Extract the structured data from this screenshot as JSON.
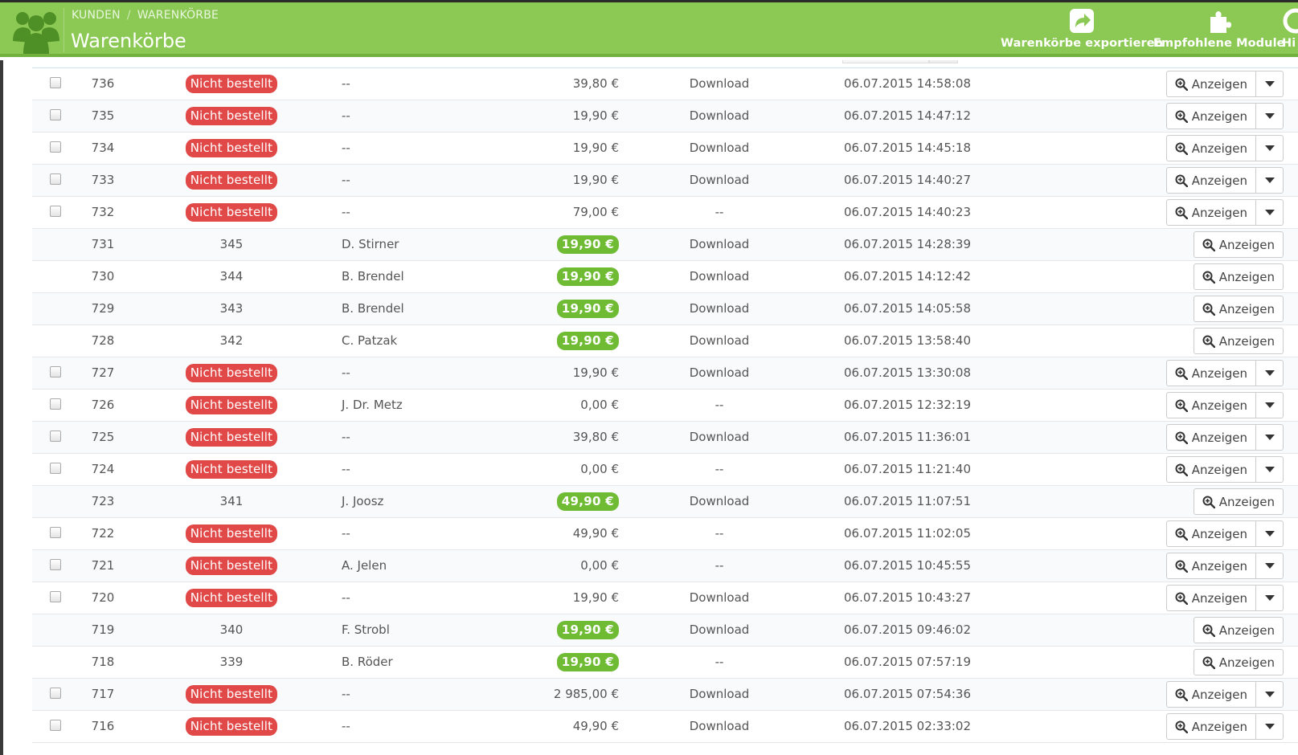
{
  "header": {
    "breadcrumb": [
      "KUNDEN",
      "WARENKÖRBE"
    ],
    "title": "Warenkörbe",
    "logo_icon": "customers-group-icon",
    "buttons": [
      {
        "icon": "export-share-icon",
        "label": "Warenkörbe exportieren"
      },
      {
        "icon": "puzzle-module-icon",
        "label": "Empfohlene Module"
      },
      {
        "icon": "help-lifebuoy-icon",
        "label": "Hi"
      }
    ],
    "colors": {
      "bar": "#8bc954",
      "bar_border": "#72b13e"
    }
  },
  "table": {
    "view_label": "Anzeigen",
    "rows": [
      {
        "id": "736",
        "ordered": false,
        "order": "Nicht bestellt",
        "customer": "--",
        "total": "39,80 €",
        "carrier": "Download",
        "date": "06.07.2015 14:58:08"
      },
      {
        "id": "735",
        "ordered": false,
        "order": "Nicht bestellt",
        "customer": "--",
        "total": "19,90 €",
        "carrier": "Download",
        "date": "06.07.2015 14:47:12"
      },
      {
        "id": "734",
        "ordered": false,
        "order": "Nicht bestellt",
        "customer": "--",
        "total": "19,90 €",
        "carrier": "Download",
        "date": "06.07.2015 14:45:18"
      },
      {
        "id": "733",
        "ordered": false,
        "order": "Nicht bestellt",
        "customer": "--",
        "total": "19,90 €",
        "carrier": "Download",
        "date": "06.07.2015 14:40:27"
      },
      {
        "id": "732",
        "ordered": false,
        "order": "Nicht bestellt",
        "customer": "--",
        "total": "79,00 €",
        "carrier": "--",
        "date": "06.07.2015 14:40:23"
      },
      {
        "id": "731",
        "ordered": true,
        "order": "345",
        "customer": "D. Stirner",
        "total": "19,90 €",
        "carrier": "Download",
        "date": "06.07.2015 14:28:39"
      },
      {
        "id": "730",
        "ordered": true,
        "order": "344",
        "customer": "B. Brendel",
        "total": "19,90 €",
        "carrier": "Download",
        "date": "06.07.2015 14:12:42"
      },
      {
        "id": "729",
        "ordered": true,
        "order": "343",
        "customer": "B. Brendel",
        "total": "19,90 €",
        "carrier": "Download",
        "date": "06.07.2015 14:05:58"
      },
      {
        "id": "728",
        "ordered": true,
        "order": "342",
        "customer": "C. Patzak",
        "total": "19,90 €",
        "carrier": "Download",
        "date": "06.07.2015 13:58:40"
      },
      {
        "id": "727",
        "ordered": false,
        "order": "Nicht bestellt",
        "customer": "--",
        "total": "19,90 €",
        "carrier": "Download",
        "date": "06.07.2015 13:30:08"
      },
      {
        "id": "726",
        "ordered": false,
        "order": "Nicht bestellt",
        "customer": "J. Dr. Metz",
        "total": "0,00 €",
        "carrier": "--",
        "date": "06.07.2015 12:32:19"
      },
      {
        "id": "725",
        "ordered": false,
        "order": "Nicht bestellt",
        "customer": "--",
        "total": "39,80 €",
        "carrier": "Download",
        "date": "06.07.2015 11:36:01"
      },
      {
        "id": "724",
        "ordered": false,
        "order": "Nicht bestellt",
        "customer": "--",
        "total": "0,00 €",
        "carrier": "--",
        "date": "06.07.2015 11:21:40"
      },
      {
        "id": "723",
        "ordered": true,
        "order": "341",
        "customer": "J. Joosz",
        "total": "49,90 €",
        "carrier": "Download",
        "date": "06.07.2015 11:07:51"
      },
      {
        "id": "722",
        "ordered": false,
        "order": "Nicht bestellt",
        "customer": "--",
        "total": "49,90 €",
        "carrier": "--",
        "date": "06.07.2015 11:02:05"
      },
      {
        "id": "721",
        "ordered": false,
        "order": "Nicht bestellt",
        "customer": "A. Jelen",
        "total": "0,00 €",
        "carrier": "--",
        "date": "06.07.2015 10:45:55"
      },
      {
        "id": "720",
        "ordered": false,
        "order": "Nicht bestellt",
        "customer": "--",
        "total": "19,90 €",
        "carrier": "Download",
        "date": "06.07.2015 10:43:27"
      },
      {
        "id": "719",
        "ordered": true,
        "order": "340",
        "customer": "F. Strobl",
        "total": "19,90 €",
        "carrier": "Download",
        "date": "06.07.2015 09:46:02"
      },
      {
        "id": "718",
        "ordered": true,
        "order": "339",
        "customer": "B. Röder",
        "total": "19,90 €",
        "carrier": "--",
        "date": "06.07.2015 07:57:19"
      },
      {
        "id": "717",
        "ordered": false,
        "order": "Nicht bestellt",
        "customer": "--",
        "total": "2 985,00 €",
        "carrier": "Download",
        "date": "06.07.2015 07:54:36"
      },
      {
        "id": "716",
        "ordered": false,
        "order": "Nicht bestellt",
        "customer": "--",
        "total": "49,90 €",
        "carrier": "Download",
        "date": "06.07.2015 02:33:02"
      }
    ],
    "colors": {
      "not_ordered_badge": "#e04948",
      "ordered_total_badge": "#6fbb34"
    }
  }
}
